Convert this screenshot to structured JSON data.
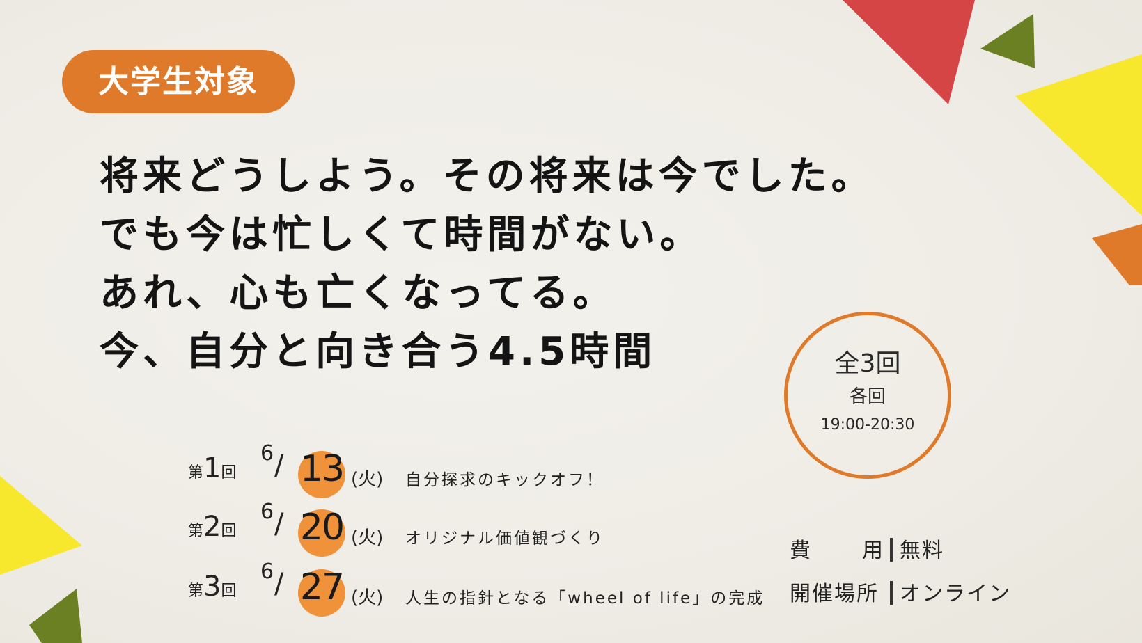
{
  "colors": {
    "orange": "#e07a2b",
    "light_orange": "#f0923a",
    "red": "#d64545",
    "yellow": "#f7e82e",
    "green": "#6b7f23"
  },
  "badge": {
    "text": "大学生対象"
  },
  "headline": {
    "lines": [
      "将来どうしよう。その将来は今でした。",
      "でも今は忙しくて時間がない。",
      "あれ、心も亡くなってる。",
      "今、自分と向き合う4.5時間"
    ]
  },
  "circle": {
    "total": "全3回",
    "each": "各回",
    "time": "19:00-20:30"
  },
  "sessions": [
    {
      "dai": "第",
      "num": "1",
      "kai": "回",
      "month": "6",
      "slash": "/",
      "day": "13",
      "dow": "(火)",
      "title": "自分探求のキックオフ！"
    },
    {
      "dai": "第",
      "num": "2",
      "kai": "回",
      "month": "6",
      "slash": "/",
      "day": "20",
      "dow": "(火)",
      "title": "オリジナル価値観づくり"
    },
    {
      "dai": "第",
      "num": "3",
      "kai": "回",
      "month": "6",
      "slash": "/",
      "day": "27",
      "dow": "(火)",
      "title": "人生の指針となる「wheel of life」の完成"
    }
  ],
  "info": {
    "cost_label": "費用",
    "cost_value": "無料",
    "venue_label": "開催場所",
    "venue_value": "オンライン"
  }
}
